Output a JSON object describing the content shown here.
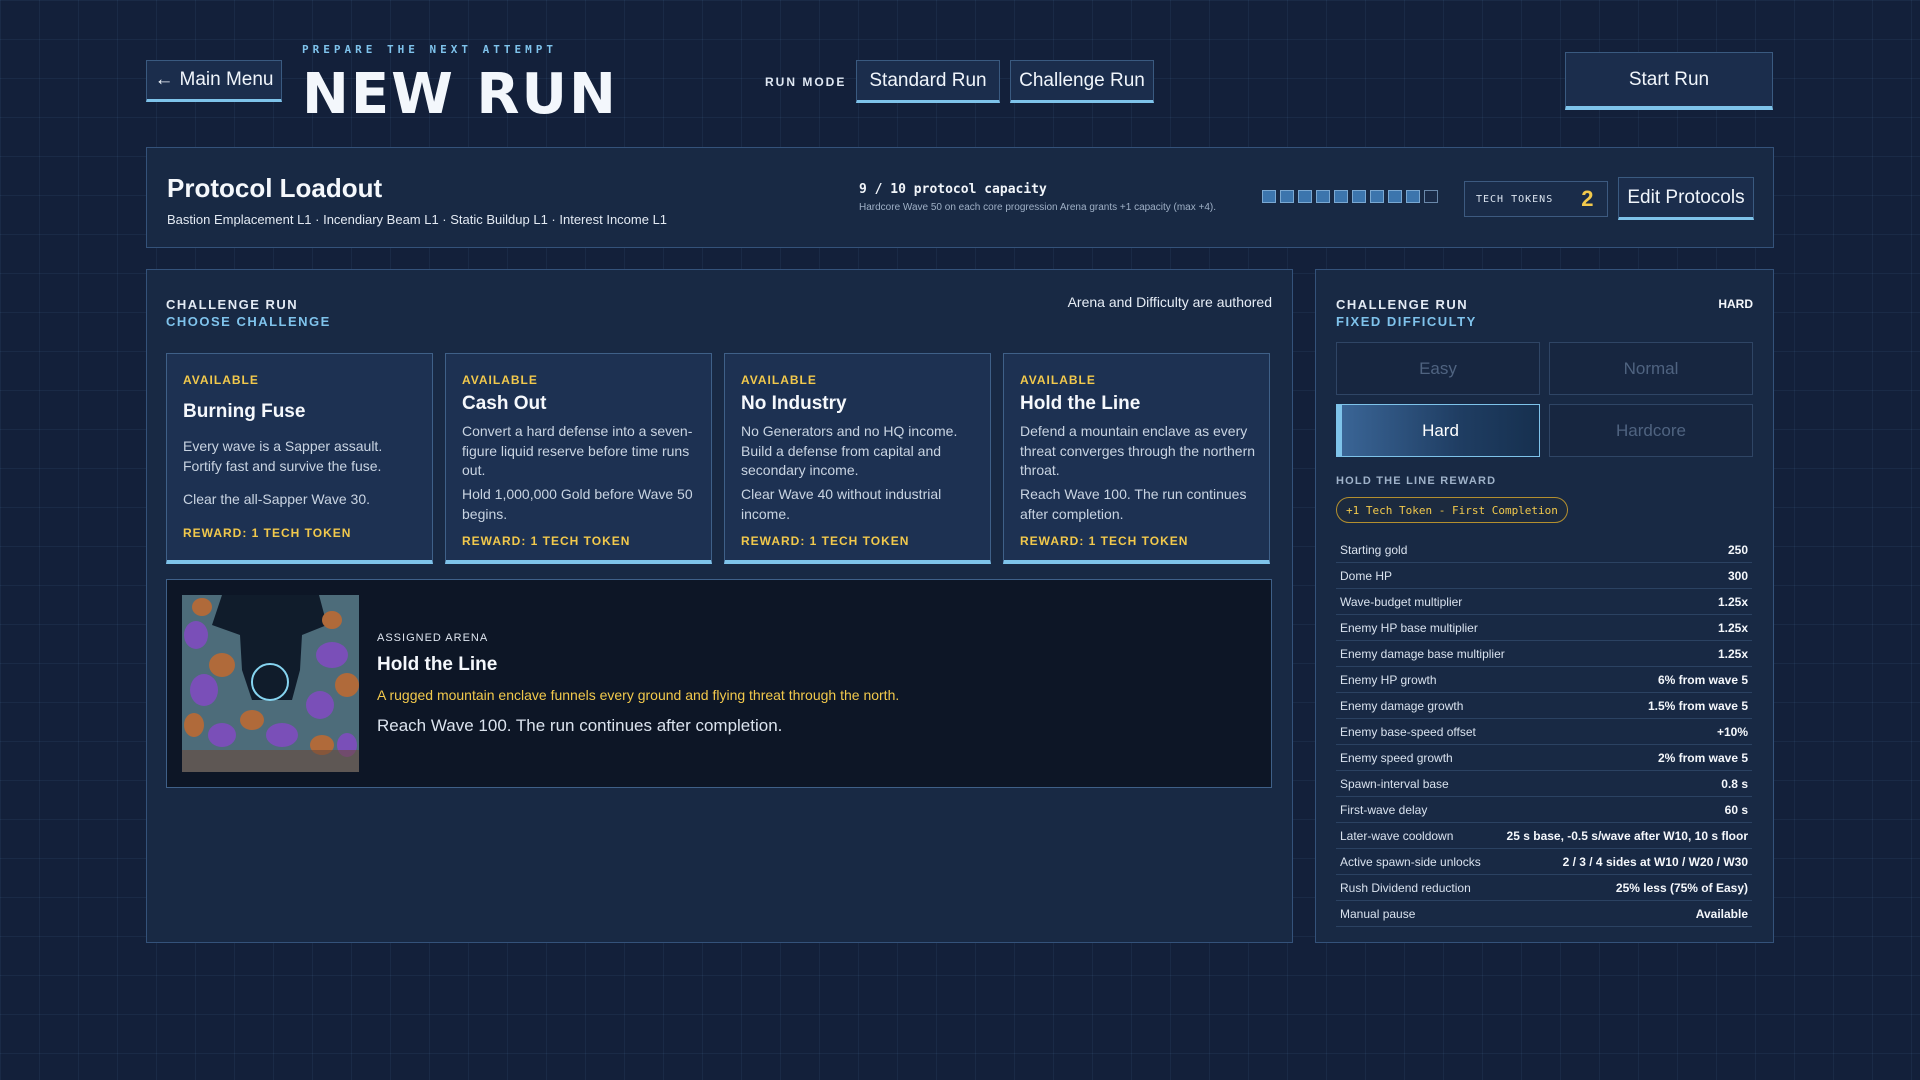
{
  "header": {
    "back_label": "Main Menu",
    "kicker": "PREPARE THE NEXT ATTEMPT",
    "title": "NEW RUN",
    "run_mode_label": "RUN MODE",
    "modes": [
      "Standard Run",
      "Challenge Run"
    ],
    "start_label": "Start Run"
  },
  "loadout": {
    "title": "Protocol Loadout",
    "protocols": "Bastion Emplacement L1 · Incendiary Beam L1 · Static Buildup L1 · Interest Income L1",
    "capacity_text": "9 / 10 protocol capacity",
    "capacity_note": "Hardcore Wave 50 on each core progression Arena grants +1 capacity (max +4).",
    "capacity_used": 9,
    "capacity_max": 10,
    "tokens_label": "TECH TOKENS",
    "tokens_value": "2",
    "edit_label": "Edit Protocols"
  },
  "challenge": {
    "section_label": "CHALLENGE RUN",
    "section_sub": "CHOOSE CHALLENGE",
    "authored_note": "Arena and Difficulty are authored",
    "cards": [
      {
        "status": "AVAILABLE",
        "title": "Burning Fuse",
        "desc": "Every wave is a Sapper assault. Fortify fast and survive the fuse.",
        "goal": "Clear the all-Sapper Wave 30.",
        "reward": "REWARD: 1 TECH TOKEN"
      },
      {
        "status": "AVAILABLE",
        "title": "Cash Out",
        "desc": "Convert a hard defense into a seven-figure liquid reserve before time runs out.",
        "goal": "Hold 1,000,000 Gold before Wave 50 begins.",
        "reward": "REWARD: 1 TECH TOKEN"
      },
      {
        "status": "AVAILABLE",
        "title": "No Industry",
        "desc": "No Generators and no HQ income. Build a defense from capital and secondary income.",
        "goal": "Clear Wave 40 without industrial income.",
        "reward": "REWARD: 1 TECH TOKEN"
      },
      {
        "status": "AVAILABLE",
        "title": "Hold the Line",
        "desc": "Defend a mountain enclave as every threat converges through the northern throat.",
        "goal": "Reach Wave 100. The run continues after completion.",
        "reward": "REWARD: 1 TECH TOKEN"
      }
    ],
    "arena": {
      "label": "ASSIGNED ARENA",
      "name": "Hold the Line",
      "flavor": "A rugged mountain enclave funnels every ground and flying threat through the north.",
      "goal": "Reach Wave 100. The run continues after completion."
    }
  },
  "difficulty": {
    "section_label": "CHALLENGE RUN",
    "section_sub": "FIXED DIFFICULTY",
    "current": "HARD",
    "options": [
      "Easy",
      "Normal",
      "Hard",
      "Hardcore"
    ],
    "selected": "Hard",
    "reward_label": "HOLD THE LINE REWARD",
    "reward_pill": "+1 Tech Token - First Completion",
    "stats": [
      {
        "k": "Starting gold",
        "v": "250"
      },
      {
        "k": "Dome HP",
        "v": "300"
      },
      {
        "k": "Wave-budget multiplier",
        "v": "1.25x"
      },
      {
        "k": "Enemy HP base multiplier",
        "v": "1.25x"
      },
      {
        "k": "Enemy damage base multiplier",
        "v": "1.25x"
      },
      {
        "k": "Enemy HP growth",
        "v": "6% from wave 5"
      },
      {
        "k": "Enemy damage growth",
        "v": "1.5% from wave 5"
      },
      {
        "k": "Enemy base-speed offset",
        "v": "+10%"
      },
      {
        "k": "Enemy speed growth",
        "v": "2% from wave 5"
      },
      {
        "k": "Spawn-interval base",
        "v": "0.8 s"
      },
      {
        "k": "First-wave delay",
        "v": "60 s"
      },
      {
        "k": "Later-wave cooldown",
        "v": "25 s base, -0.5 s/wave after W10, 10 s floor"
      },
      {
        "k": "Active spawn-side unlocks",
        "v": "2 / 3 / 4 sides at W10 / W20 / W30"
      },
      {
        "k": "Rush Dividend reduction",
        "v": "25% less (75% of Easy)"
      },
      {
        "k": "Manual pause",
        "v": "Available"
      }
    ]
  }
}
